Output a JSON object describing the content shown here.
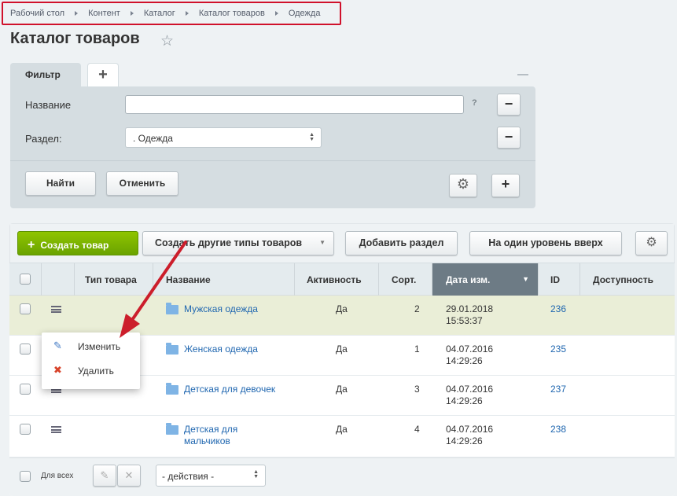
{
  "breadcrumb": [
    "Рабочий стол",
    "Контент",
    "Каталог",
    "Каталог товаров",
    "Одежда"
  ],
  "page_title": "Каталог товаров",
  "filter": {
    "tab_label": "Фильтр",
    "add_tab_glyph": "+",
    "name_label": "Название",
    "name_value": "",
    "help_glyph": "?",
    "section_label": "Раздел:",
    "section_value": ". Одежда",
    "find_button": "Найти",
    "cancel_button": "Отменить"
  },
  "toolbar": {
    "create_button": "Создать товар",
    "create_other_button": "Создать другие типы товаров",
    "add_section_button": "Добавить раздел",
    "level_up_button": "На один уровень вверх"
  },
  "columns": {
    "type": "Тип товара",
    "name": "Название",
    "active": "Активность",
    "sort": "Сорт.",
    "date": "Дата изм.",
    "id": "ID",
    "availability": "Доступность"
  },
  "rows": [
    {
      "name": "Мужская одежда",
      "active": "Да",
      "sort": "2",
      "date": "29.01.2018",
      "time": "15:53:37",
      "id": "236"
    },
    {
      "name": "Женская одежда",
      "active": "Да",
      "sort": "1",
      "date": "04.07.2016",
      "time": "14:29:26",
      "id": "235"
    },
    {
      "name": "Детская для девочек",
      "active": "Да",
      "sort": "3",
      "date": "04.07.2016",
      "time": "14:29:26",
      "id": "237"
    },
    {
      "name": "Детская для мальчиков",
      "active": "Да",
      "sort": "4",
      "date": "04.07.2016",
      "time": "14:29:26",
      "id": "238"
    }
  ],
  "context_menu": {
    "edit": "Изменить",
    "delete": "Удалить"
  },
  "footer": {
    "for_all": "Для всех",
    "actions_select": "- действия -"
  },
  "colors": {
    "highlight_border": "#d0112b",
    "green_button": "#76ac00",
    "arrow": "#cc1e2b",
    "link": "#2067b0"
  }
}
